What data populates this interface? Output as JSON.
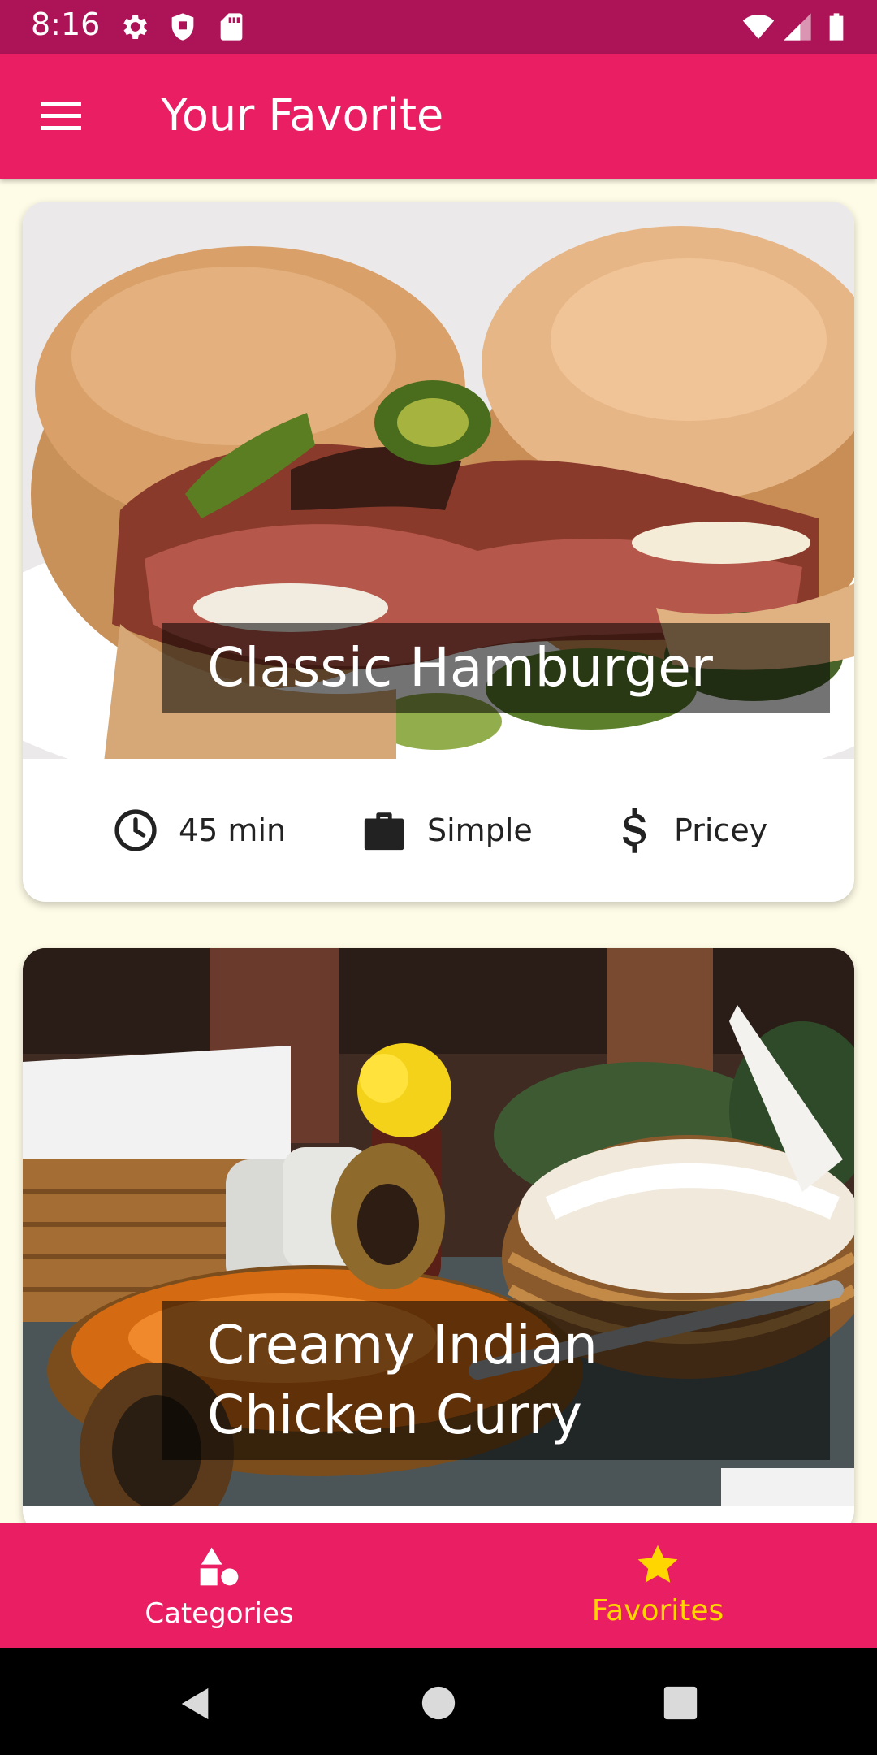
{
  "status_bar": {
    "time": "8:16",
    "icons": [
      "settings-icon",
      "shield-icon",
      "sd-card-icon",
      "wifi-icon",
      "signal-icon",
      "battery-icon"
    ]
  },
  "app_bar": {
    "menu_icon": "menu-icon",
    "title": "Your Favorite"
  },
  "meals": [
    {
      "title": "Classic Hamburger",
      "duration": "45 min",
      "complexity": "Simple",
      "affordability": "Pricey"
    },
    {
      "title_lines": [
        "Creamy Indian",
        "Chicken Curry"
      ]
    }
  ],
  "bottom_nav": {
    "items": [
      {
        "label": "Categories",
        "icon": "categories-icon",
        "active": false
      },
      {
        "label": "Favorites",
        "icon": "star-icon",
        "active": true
      }
    ]
  },
  "colors": {
    "primary": "#e91e63",
    "primary_dark": "#ad1457",
    "accent": "#ffd600",
    "background": "#fefce6",
    "on_primary": "#ffffff"
  }
}
